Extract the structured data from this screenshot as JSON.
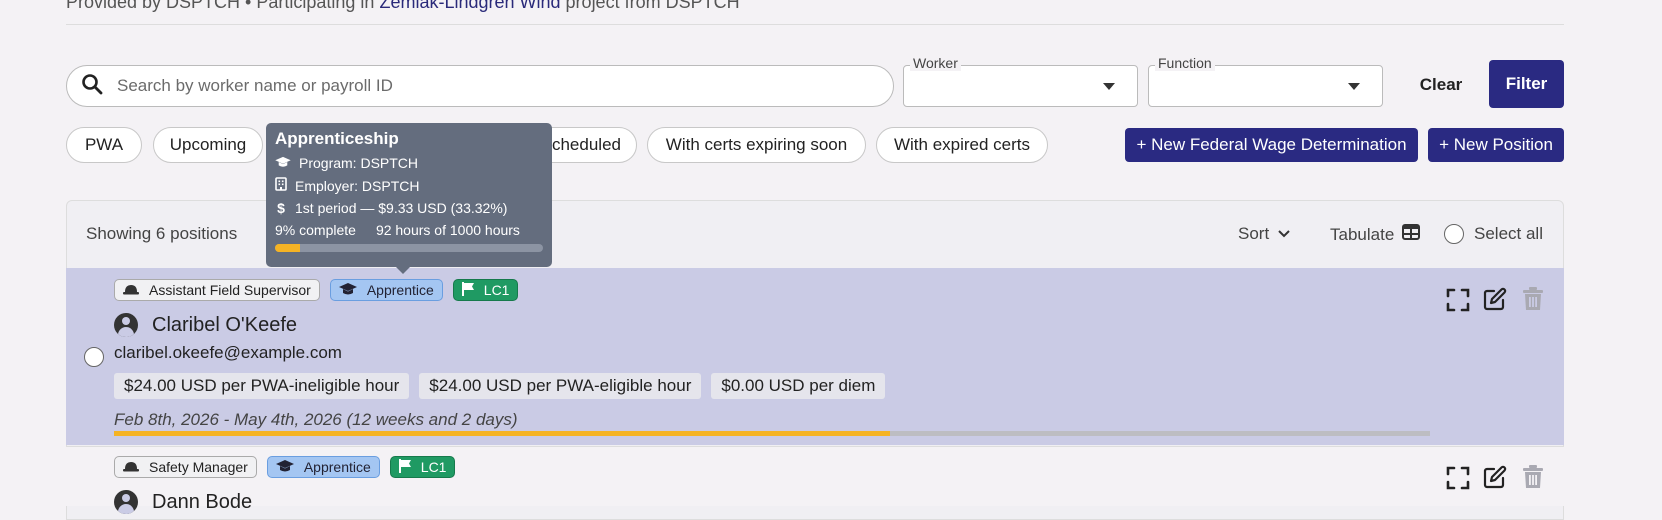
{
  "header": {
    "provided_prefix": "Provided by DSPTCH • Participating in",
    "project_link": "Zemlak-Lindgren Wind",
    "provided_suffix": "project from DSPTCH"
  },
  "search": {
    "placeholder": "Search by worker name or payroll ID",
    "value": ""
  },
  "filters": {
    "worker_label": "Worker",
    "function_label": "Function",
    "clear_label": "Clear",
    "filter_label": "Filter"
  },
  "chips": [
    "PWA",
    "Upcoming",
    "Unscheduled",
    "With certs expiring soon",
    "With expired certs"
  ],
  "actions": {
    "new_fwd": "+ New Federal Wage Determination",
    "new_position": "+ New Position"
  },
  "list": {
    "showing": "Showing 6 positions",
    "sort_label": "Sort",
    "tabulate_label": "Tabulate",
    "select_all_label": "Select all"
  },
  "tooltip": {
    "title": "Apprenticeship",
    "program": "Program: DSPTCH",
    "employer": "Employer: DSPTCH",
    "period": "1st period — $9.33 USD (33.32%)",
    "complete": "9% complete",
    "hours": "92 hours of 1000 hours",
    "progress_fraction": 0.092
  },
  "rows": [
    {
      "role": "Assistant Field Supervisor",
      "type": "Apprentice",
      "level": "LC1",
      "name": "Claribel O'Keefe",
      "email": "claribel.okeefe@example.com",
      "rates": [
        "$24.00 USD per PWA-ineligible hour",
        "$24.00 USD per PWA-eligible hour",
        "$0.00 USD per diem"
      ],
      "dates": "Feb 8th, 2026 - May 4th, 2026 (12 weeks and 2 days)",
      "progress_fraction": 0.59
    },
    {
      "role": "Safety Manager",
      "type": "Apprentice",
      "level": "LC1",
      "name": "Dann Bode"
    }
  ],
  "colors": {
    "primary": "#2a2a82",
    "selected_row": "#cacbe5",
    "progress": "#f5b324",
    "level_badge": "#1f9a63",
    "type_badge": "#a4c6f2"
  },
  "icons": {
    "search": "search-icon",
    "caret": "caret-down-icon",
    "hardhat": "hard-hat-icon",
    "graduation": "graduation-cap-icon",
    "flag": "flag-icon",
    "person": "person-circle-icon",
    "expand": "expand-icon",
    "edit": "edit-icon",
    "trash": "trash-icon",
    "table": "table-icon",
    "chevron": "chevron-down-icon",
    "building": "building-icon",
    "dollar": "dollar-icon"
  }
}
